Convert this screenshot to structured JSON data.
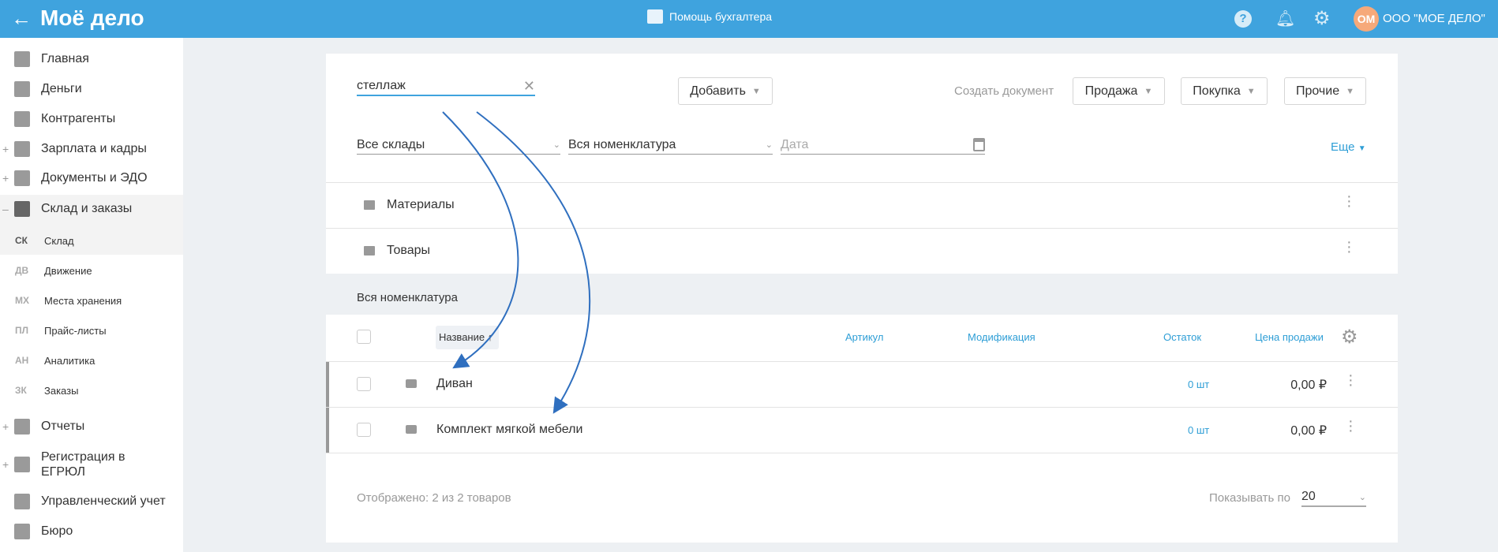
{
  "topbar": {
    "logo": "Моё дело",
    "help_center": "Помощь бухгалтера",
    "avatar_initials": "ОМ",
    "company": "ООО \"МОЕ ДЕЛО\""
  },
  "sidebar": {
    "items": [
      {
        "label": "Главная",
        "expand": ""
      },
      {
        "label": "Деньги",
        "expand": ""
      },
      {
        "label": "Контрагенты",
        "expand": ""
      },
      {
        "label": "Зарплата и кадры",
        "expand": "+"
      },
      {
        "label": "Документы и ЭДО",
        "expand": "+"
      },
      {
        "label": "Склад и заказы",
        "expand": "–"
      }
    ],
    "subitems": [
      {
        "abbr": "СК",
        "label": "Склад"
      },
      {
        "abbr": "ДВ",
        "label": "Движение"
      },
      {
        "abbr": "МХ",
        "label": "Места хранения"
      },
      {
        "abbr": "ПЛ",
        "label": "Прайс-листы"
      },
      {
        "abbr": "АН",
        "label": "Аналитика"
      },
      {
        "abbr": "ЗК",
        "label": "Заказы"
      }
    ],
    "bottom": [
      {
        "label": "Отчеты",
        "expand": "+"
      },
      {
        "label": "Регистрация в ЕГРЮЛ",
        "expand": "+"
      },
      {
        "label": "Управленческий учет",
        "expand": ""
      },
      {
        "label": "Бюро",
        "expand": ""
      }
    ]
  },
  "toolbar": {
    "search_value": "стеллаж",
    "add_label": "Добавить",
    "create_doc_label": "Создать документ",
    "sale": "Продажа",
    "purchase": "Покупка",
    "other": "Прочие"
  },
  "filters": {
    "warehouse": "Все склады",
    "nomenclature": "Вся номенклатура",
    "date_placeholder": "Дата",
    "more": "Еще"
  },
  "folders": [
    "Материалы",
    "Товары"
  ],
  "section_title": "Вся номенклатура",
  "table": {
    "columns": {
      "name": "Название ↑",
      "article": "Артикул",
      "modification": "Модификация",
      "stock": "Остаток",
      "price": "Цена продажи"
    },
    "rows": [
      {
        "name": "Диван",
        "stock": "0 шт",
        "price": "0,00 ₽"
      },
      {
        "name": "Комплект мягкой мебели",
        "stock": "0 шт",
        "price": "0,00 ₽"
      }
    ]
  },
  "footer": {
    "shown": "Отображено: 2 из 2 товаров",
    "page_size_label": "Показывать по",
    "page_size": "20"
  },
  "colors": {
    "topbar": "#3fa3de",
    "link": "#2e9ed6",
    "annotation": "#2f6fbf",
    "avatar": "#f6a97a"
  }
}
